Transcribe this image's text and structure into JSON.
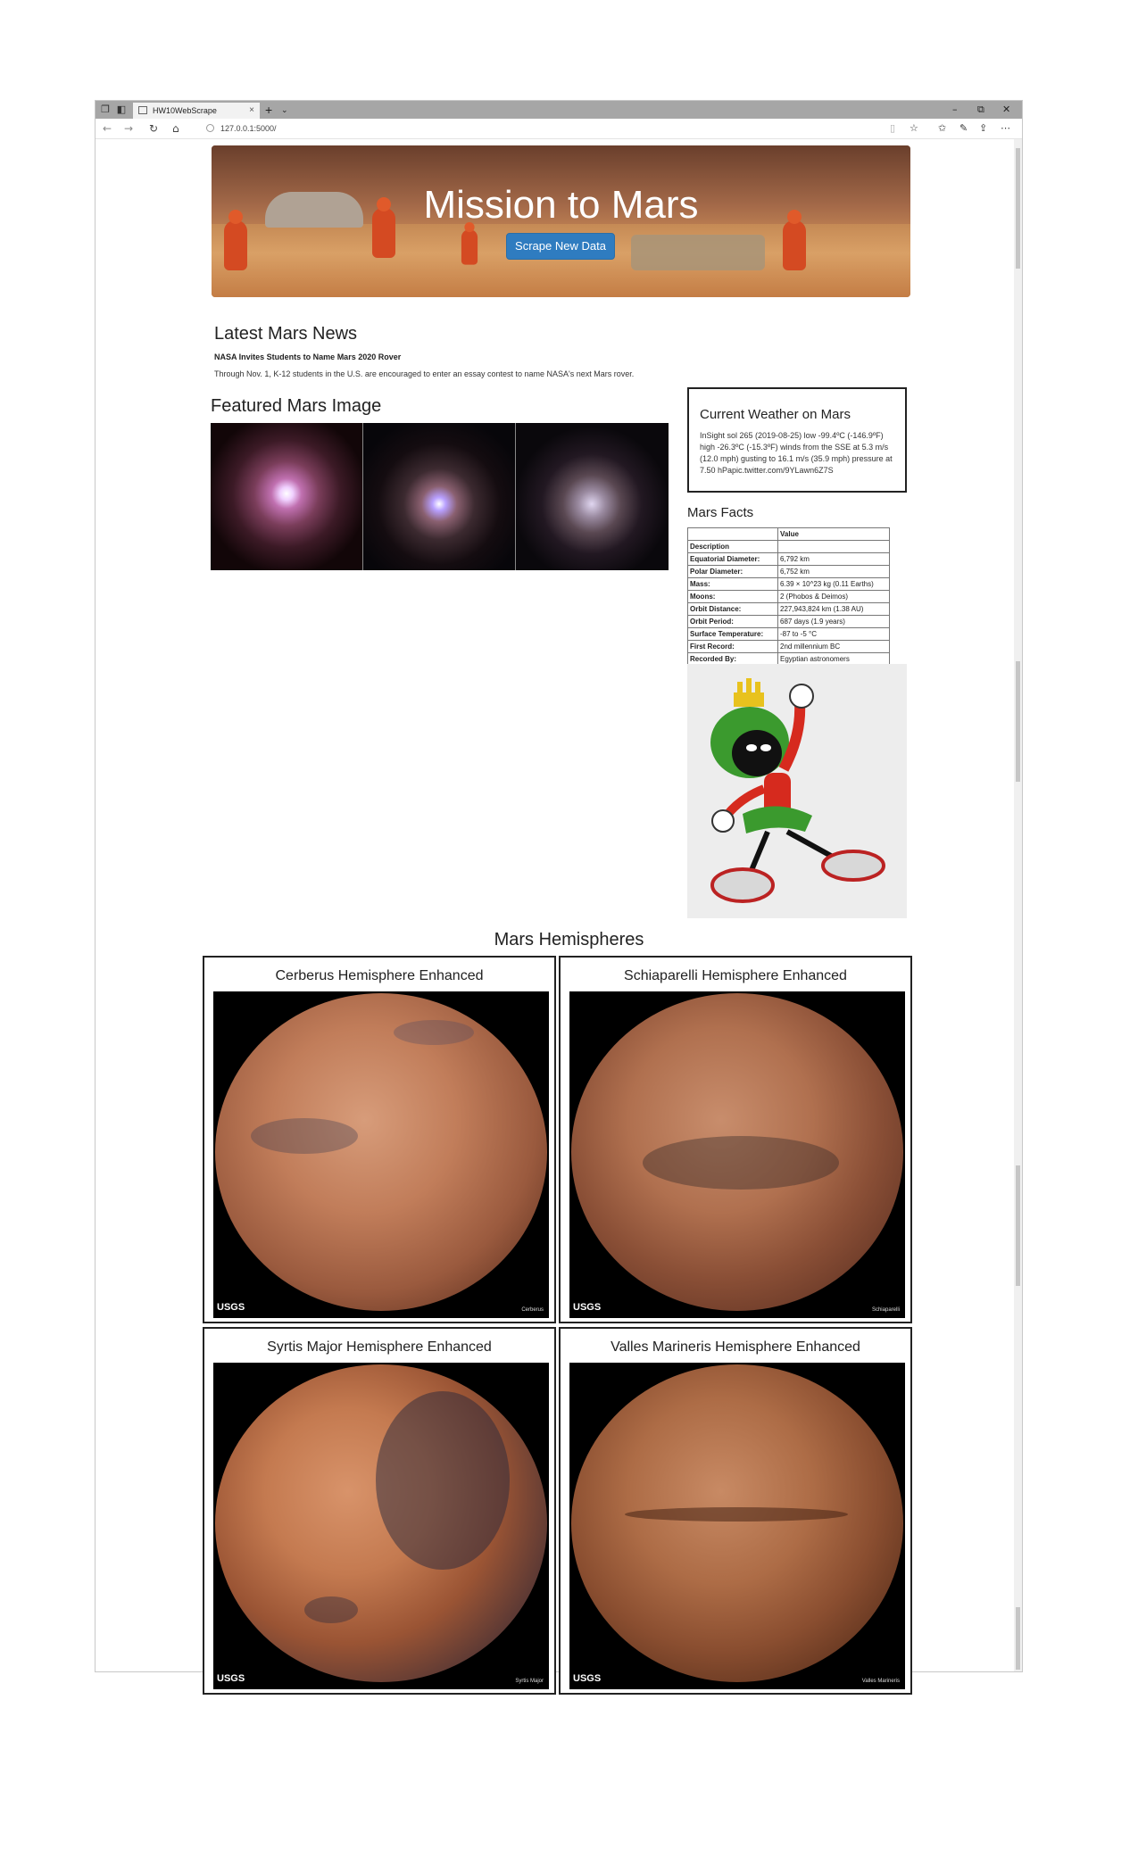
{
  "browser": {
    "tab_title": "HW10WebScrape",
    "url": "127.0.0.1:5000/",
    "new_tab_label": "+",
    "tab_close": "×"
  },
  "jumbotron": {
    "title": "Mission to Mars",
    "button_label": "Scrape New Data"
  },
  "news": {
    "heading": "Latest Mars News",
    "title": "NASA Invites Students to Name Mars 2020 Rover",
    "body": "Through Nov. 1, K-12 students in the U.S. are encouraged to enter an essay contest to name NASA's next Mars rover."
  },
  "featured": {
    "heading": "Featured Mars Image"
  },
  "weather": {
    "heading": "Current Weather on Mars",
    "body": "InSight sol 265 (2019-08-25) low -99.4ºC (-146.9ºF) high -26.3ºC (-15.3ºF) winds from the SSE at 5.3 m/s (12.0 mph) gusting to 16.1 m/s (35.9 mph) pressure at 7.50 hPapic.twitter.com/9YLawn6Z7S"
  },
  "facts": {
    "heading": "Mars Facts",
    "col_header": "Value",
    "index_header": "Description",
    "rows": [
      {
        "label": "Equatorial Diameter:",
        "value": "6,792 km"
      },
      {
        "label": "Polar Diameter:",
        "value": "6,752 km"
      },
      {
        "label": "Mass:",
        "value": "6.39 × 10^23 kg (0.11 Earths)"
      },
      {
        "label": "Moons:",
        "value": "2 (Phobos & Deimos)"
      },
      {
        "label": "Orbit Distance:",
        "value": "227,943,824 km (1.38 AU)"
      },
      {
        "label": "Orbit Period:",
        "value": "687 days (1.9 years)"
      },
      {
        "label": "Surface Temperature:",
        "value": "-87 to -5 °C"
      },
      {
        "label": "First Record:",
        "value": "2nd millennium BC"
      },
      {
        "label": "Recorded By:",
        "value": "Egyptian astronomers"
      }
    ]
  },
  "hemispheres": {
    "heading": "Mars Hemispheres",
    "items": [
      {
        "title": "Cerberus Hemisphere Enhanced",
        "logo": "USGS",
        "caption": "Cerberus"
      },
      {
        "title": "Schiaparelli Hemisphere Enhanced",
        "logo": "USGS",
        "caption": "Schiaparelli"
      },
      {
        "title": "Syrtis Major Hemisphere Enhanced",
        "logo": "USGS",
        "caption": "Syrtis Major"
      },
      {
        "title": "Valles Marineris Hemisphere Enhanced",
        "logo": "USGS",
        "caption": "Valles Marineris"
      }
    ]
  },
  "icons": {
    "back": "back-arrow-icon",
    "forward": "forward-arrow-icon",
    "refresh": "refresh-icon",
    "home": "home-icon",
    "favorite": "star-icon"
  },
  "colors": {
    "button_bg": "#2f7cc0",
    "tabbar_bg": "#a6a6a6"
  }
}
